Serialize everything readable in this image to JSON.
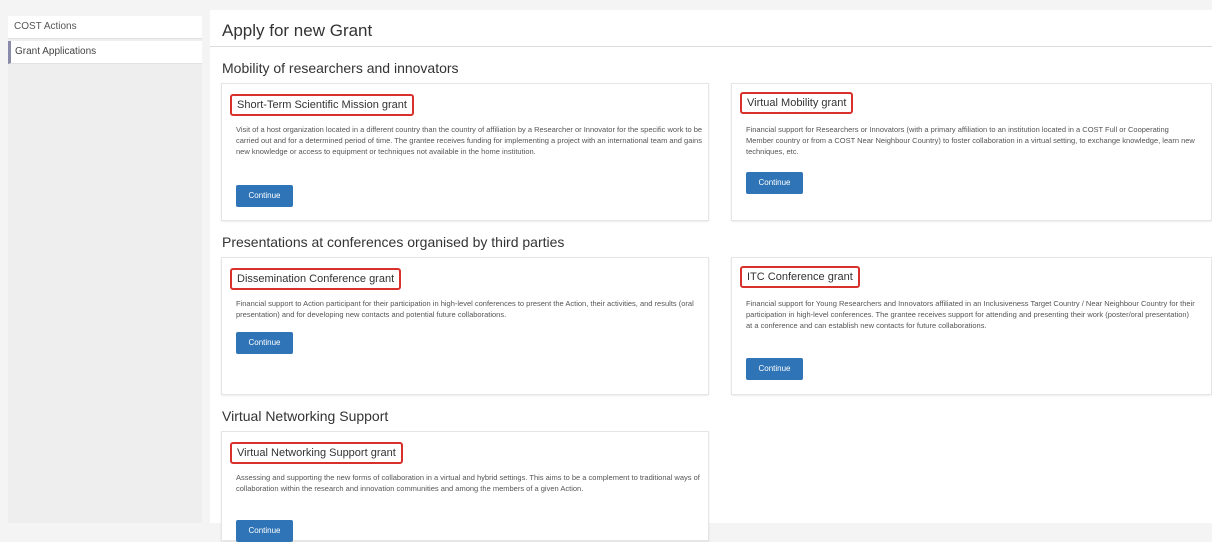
{
  "sidebar": {
    "items": [
      {
        "label": "COST Actions"
      },
      {
        "label": "Grant Applications"
      }
    ]
  },
  "page": {
    "title": "Apply for new Grant"
  },
  "sections": [
    {
      "title": "Mobility of researchers and innovators",
      "cards": [
        {
          "title": "Short-Term Scientific Mission grant",
          "description": "Visit of a host organization located in a different country than the country of affiliation by a Researcher or Innovator for the specific work to be carried out and for a determined period of time. The grantee receives funding for implementing a project with an international team and gains new knowledge or access to equipment or techniques not available in the home institution.",
          "button": "Continue"
        },
        {
          "title": "Virtual Mobility grant",
          "description": "Financial support for Researchers or Innovators (with a primary affiliation to an institution located in a COST Full or Cooperating Member country or from a COST Near Neighbour Country) to foster collaboration in a virtual setting, to exchange knowledge, learn new techniques, etc.",
          "button": "Continue"
        }
      ]
    },
    {
      "title": "Presentations at conferences organised by third parties",
      "cards": [
        {
          "title": "Dissemination Conference grant",
          "description": "Financial support to Action participant for their participation in high-level conferences to present the Action, their activities, and results (oral presentation) and for developing new contacts and potential future collaborations.",
          "button": "Continue"
        },
        {
          "title": "ITC Conference grant",
          "description": "Financial support for Young Researchers and Innovators affiliated in an Inclusiveness Target Country / Near Neighbour Country for their participation in high-level conferences. The grantee receives support for attending and presenting their work (poster/oral presentation) at a conference and can establish new contacts for future collaborations.",
          "button": "Continue"
        }
      ]
    },
    {
      "title": "Virtual Networking Support",
      "cards": [
        {
          "title": "Virtual Networking Support grant",
          "description": "Assessing and supporting the new forms of collaboration in a virtual and hybrid settings. This aims to be a complement to traditional ways of collaboration within the research and innovation communities and among the members of a given Action.",
          "button": "Continue"
        }
      ]
    }
  ],
  "colors": {
    "primary_button": "#2f74b6",
    "highlight_box": "#d9302c"
  }
}
